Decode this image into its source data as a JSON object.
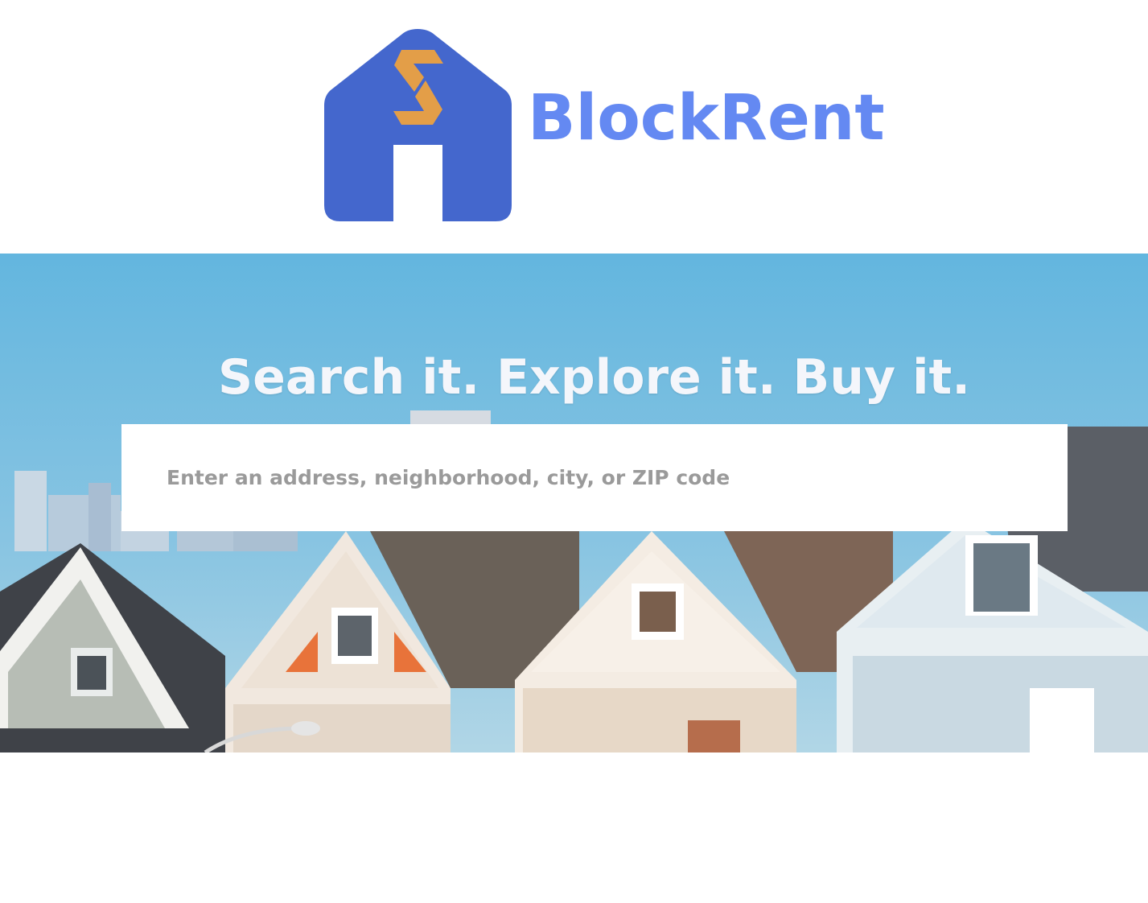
{
  "brand": {
    "name": "BlockRent",
    "logo_icon": "house-swap-icon",
    "colors": {
      "house": "#4467cd",
      "swap_arrows": "#e39e48",
      "wordmark": "#6489f2"
    }
  },
  "hero": {
    "title": "Search it. Explore it. Buy it.",
    "background_image": "victorian-row-houses-photo",
    "colors": {
      "sky": "#6cb8dc",
      "title": "#f4f6fb"
    }
  },
  "search": {
    "placeholder": "Enter an address, neighborhood, city, or ZIP code",
    "value": ""
  }
}
